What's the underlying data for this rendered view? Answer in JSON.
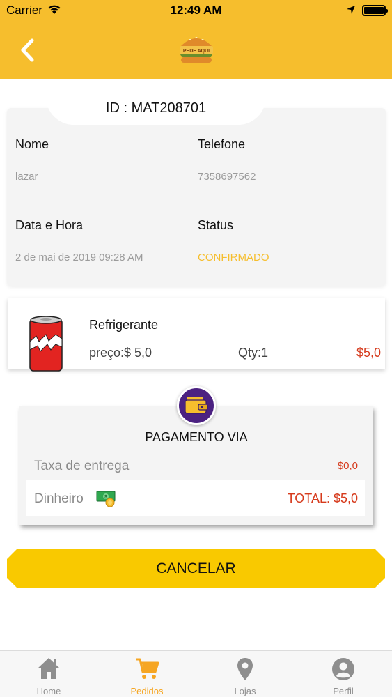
{
  "status_bar": {
    "carrier": "Carrier",
    "time": "12:49 AM"
  },
  "header": {
    "back_icon": "chevron-left-icon",
    "logo_text": "PEDE AQUI",
    "logo_icon": "burger-logo"
  },
  "order": {
    "id_label": "ID : MAT208701",
    "name_label": "Nome",
    "name_value": "lazar",
    "phone_label": "Telefone",
    "phone_value": "7358697562",
    "datetime_label": "Data e Hora",
    "datetime_value": "2 de mai de 2019 09:28 AM",
    "status_label": "Status",
    "status_value": "CONFIRMADO"
  },
  "item": {
    "name": "Refrigerante",
    "price": "preço:$ 5,0",
    "qty": "Qty:1",
    "total": "$5,0",
    "image_icon": "soda-can-icon"
  },
  "payment": {
    "title": "PAGAMENTO VIA",
    "delivery_fee_label": "Taxa de entrega",
    "delivery_fee_value": "$0,0",
    "method_label": "Dinheiro",
    "total": "TOTAL: $5,0",
    "icon": "wallet-icon"
  },
  "actions": {
    "cancel_label": "CANCELAR"
  },
  "tabs": [
    {
      "label": "Home",
      "icon": "home-icon",
      "active": false
    },
    {
      "label": "Pedidos",
      "icon": "cart-icon",
      "active": true
    },
    {
      "label": "Lojas",
      "icon": "location-pin-icon",
      "active": false
    },
    {
      "label": "Perfil",
      "icon": "user-icon",
      "active": false
    }
  ],
  "colors": {
    "header": "#f6be2d",
    "accent": "#f6a623",
    "price_red": "#d63a1c",
    "wallet_purple": "#4b2181",
    "button": "#f9c900"
  }
}
